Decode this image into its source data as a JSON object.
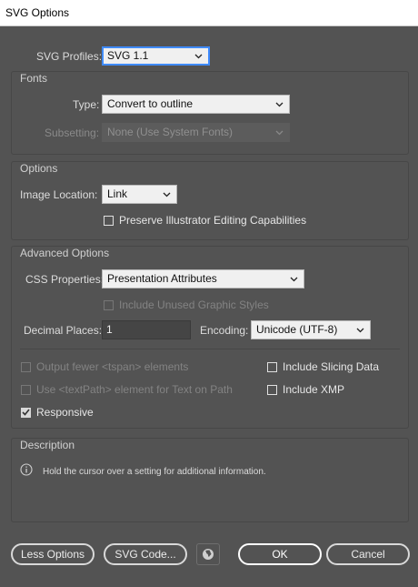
{
  "window": {
    "title": "SVG Options"
  },
  "profiles": {
    "label": "SVG Profiles:",
    "value": "SVG 1.1"
  },
  "fonts": {
    "title": "Fonts",
    "type_label": "Type:",
    "type_value": "Convert to outline",
    "subsetting_label": "Subsetting:",
    "subsetting_value": "None (Use System Fonts)"
  },
  "options": {
    "title": "Options",
    "image_location_label": "Image Location:",
    "image_location_value": "Link",
    "preserve_label": "Preserve Illustrator Editing Capabilities",
    "preserve_checked": false
  },
  "advanced": {
    "title": "Advanced Options",
    "css_label": "CSS Properties:",
    "css_value": "Presentation Attributes",
    "unused_styles_label": "Include Unused Graphic Styles",
    "decimal_label": "Decimal Places:",
    "decimal_value": "1",
    "encoding_label": "Encoding:",
    "encoding_value": "Unicode (UTF-8)",
    "tspan_label": "Output fewer <tspan> elements",
    "textpath_label": "Use <textPath> element for Text on Path",
    "responsive_label": "Responsive",
    "responsive_checked": true,
    "slicing_label": "Include Slicing Data",
    "xmp_label": "Include XMP"
  },
  "description": {
    "title": "Description",
    "text": "Hold the cursor over a setting for additional information."
  },
  "buttons": {
    "less_options": "Less Options",
    "svg_code": "SVG Code...",
    "ok": "OK",
    "cancel": "Cancel"
  },
  "icons": {
    "chevron": "chevron-down-icon",
    "info": "info-icon",
    "globe": "globe-icon",
    "check": "checkmark-icon"
  }
}
